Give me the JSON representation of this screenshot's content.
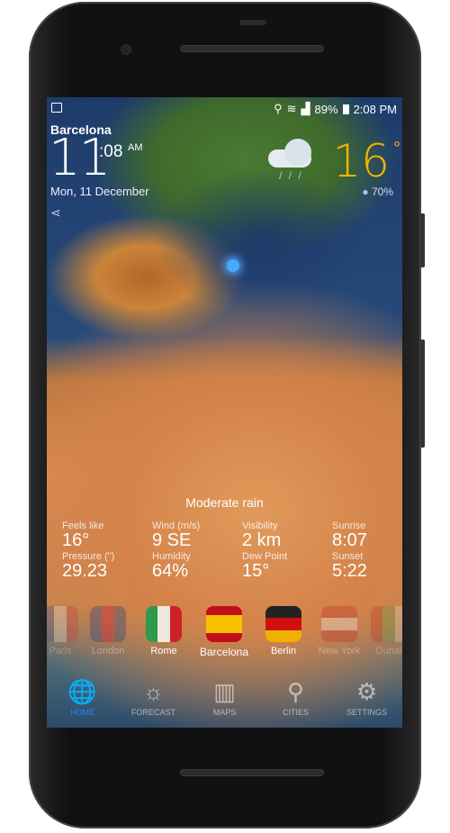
{
  "status": {
    "battery": "89%",
    "time": "2:08 PM"
  },
  "header": {
    "city": "Barcelona",
    "hour": "11",
    "minutes": ":08",
    "ampm": "AM",
    "date": "Mon, 11 December",
    "temperature": "16",
    "degree": "°",
    "humidity": "70%",
    "weather_icon": "cloud-rain-icon"
  },
  "condition": "Moderate rain",
  "details": [
    {
      "label": "Feels like",
      "value": "16°"
    },
    {
      "label": "Wind (m/s)",
      "value": "9 SE"
    },
    {
      "label": "Visibility",
      "value": "2 km"
    },
    {
      "label": "Sunrise",
      "value": "8:07"
    },
    {
      "label": "Pressure (\")",
      "value": "29.23"
    },
    {
      "label": "Humidity",
      "value": "64%"
    },
    {
      "label": "Dew Point",
      "value": "15°"
    },
    {
      "label": "Sunset",
      "value": "5:22"
    }
  ],
  "cities": [
    {
      "name": "Paris",
      "colors": [
        "#2b4ea0",
        "#ffffff",
        "#d0303a"
      ]
    },
    {
      "name": "London",
      "colors": [
        "#2b3f80",
        "#c8102e",
        "#2b3f80"
      ]
    },
    {
      "name": "Rome",
      "colors": [
        "#2e9a4a",
        "#f0e8dc",
        "#d0202a"
      ]
    },
    {
      "name": "Barcelona",
      "colors": [
        "#c0101a",
        "#f8c000",
        "#c0101a"
      ]
    },
    {
      "name": "Berlin",
      "colors": [
        "#222222",
        "#d01010",
        "#f0b000"
      ]
    },
    {
      "name": "New York",
      "colors": [
        "#c03030",
        "#eeeeee",
        "#c03030"
      ]
    },
    {
      "name": "Dubai",
      "colors": [
        "#c02020",
        "#4aa040",
        "#eeeeee"
      ]
    }
  ],
  "nav": [
    {
      "label": "HOME",
      "icon": "globe-icon",
      "active": true
    },
    {
      "label": "FORECAST",
      "icon": "sun-cloud-icon"
    },
    {
      "label": "MAPS",
      "icon": "map-icon"
    },
    {
      "label": "CITIES",
      "icon": "location-pin-icon"
    },
    {
      "label": "SETTINGS",
      "icon": "gear-icon"
    }
  ],
  "accent": "#1e88ff",
  "temp_color": "#f4b400"
}
